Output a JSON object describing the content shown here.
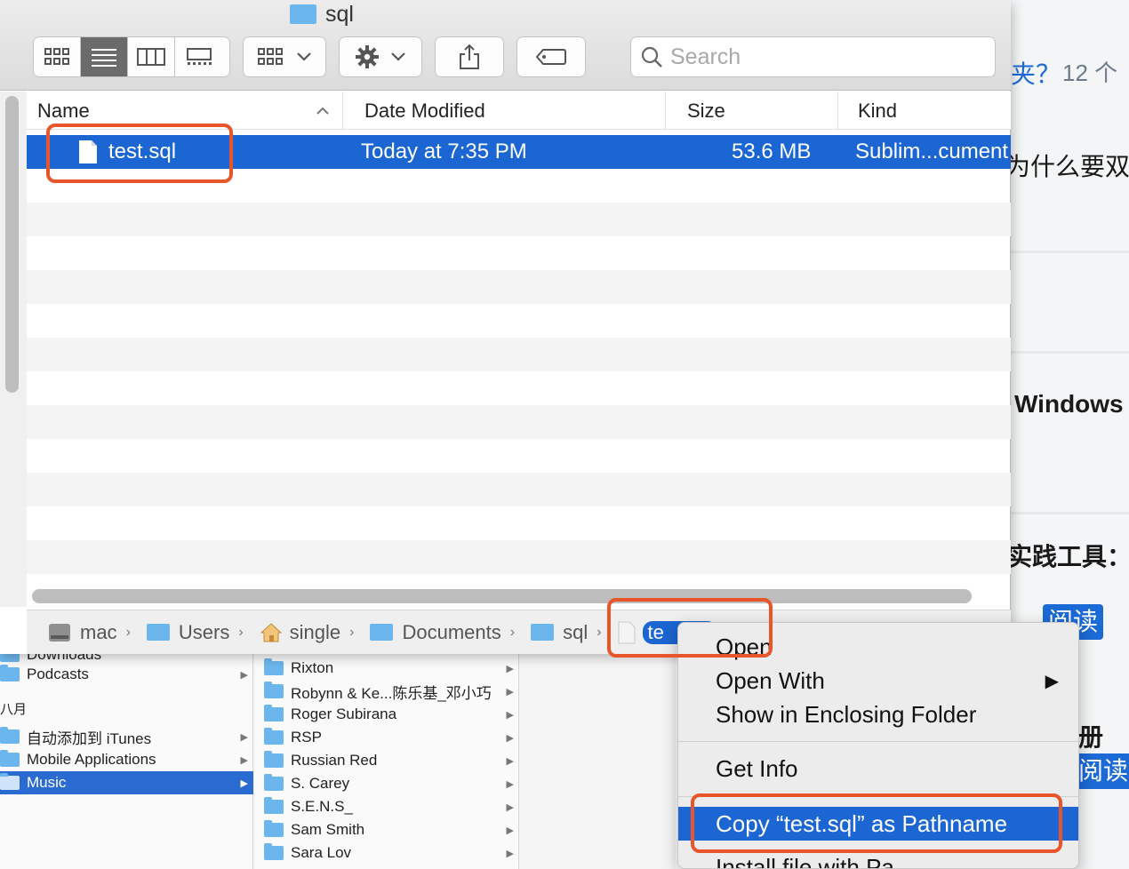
{
  "window": {
    "title": "sql"
  },
  "toolbar": {
    "search_placeholder": "Search"
  },
  "columns": {
    "name": "Name",
    "date": "Date Modified",
    "size": "Size",
    "kind": "Kind"
  },
  "file": {
    "name": "test.sql",
    "date": "Today at 7:35 PM",
    "size": "53.6 MB",
    "kind": "Sublim...cument"
  },
  "pathbar": {
    "items": [
      "mac",
      "Users",
      "single",
      "Documents",
      "sql",
      "te"
    ]
  },
  "context_menu": {
    "items": [
      "Open",
      "Open With",
      "Show in Enclosing Folder",
      "Get Info",
      "Copy “test.sql” as Pathname",
      "Install file with Pa..."
    ],
    "submenu_arrow": "▶"
  },
  "background_page": {
    "t1": "夹？",
    "t1_count": "12 个",
    "t2": "为什么要双",
    "t3": "Windows",
    "t4": "实践工具：",
    "t5": "阅读",
    "t6": "册",
    "t7": "阅读"
  },
  "bottom_finder": {
    "col1": [
      "Downloads",
      "Podcasts",
      "八月",
      "自动添加到 iTunes",
      "Mobile Applications",
      "Music"
    ],
    "col2": [
      "Rixton",
      "Robynn & Ke...陈乐基_邓小巧",
      "Roger Subirana",
      "RSP",
      "Russian Red",
      "S. Carey",
      "S.E.N.S_",
      "Sam Smith",
      "Sara Lov"
    ]
  },
  "colors": {
    "selection": "#1b66d2",
    "highlight_box": "#e8552a",
    "folder": "#6cb6ee"
  }
}
